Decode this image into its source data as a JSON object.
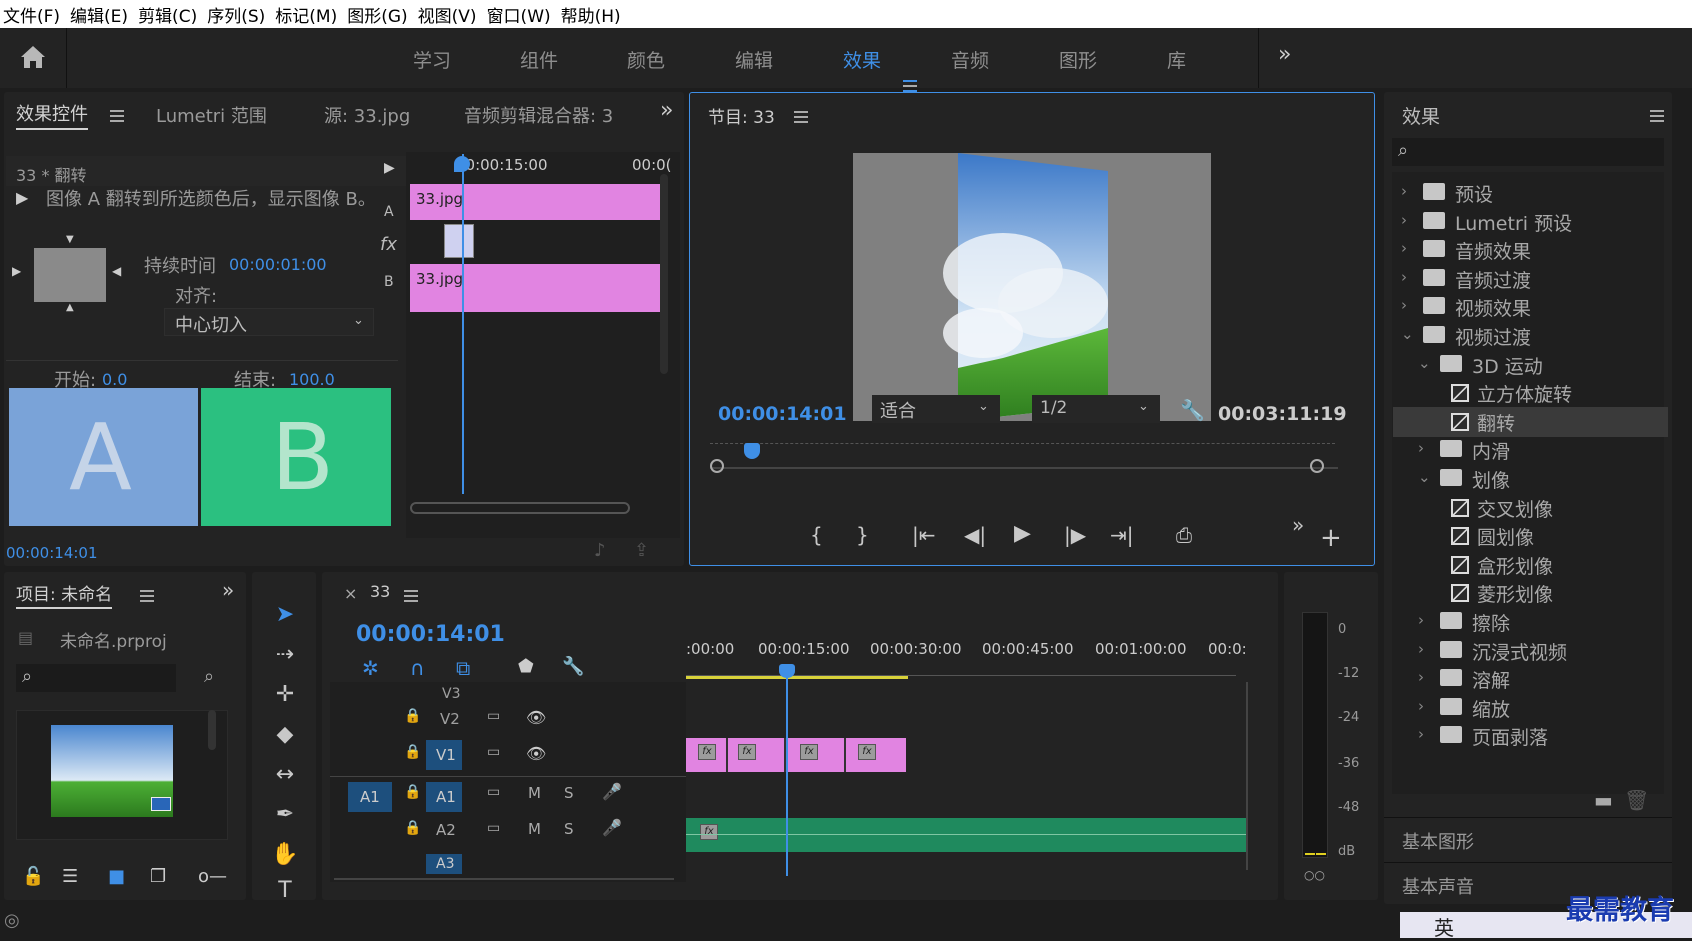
{
  "menu": [
    "文件(F)",
    "编辑(E)",
    "剪辑(C)",
    "序列(S)",
    "标记(M)",
    "图形(G)",
    "视图(V)",
    "窗口(W)",
    "帮助(H)"
  ],
  "workspaces": [
    "学习",
    "组件",
    "颜色",
    "编辑",
    "效果",
    "音频",
    "图形",
    "库"
  ],
  "workspace_active": "效果",
  "effect_controls": {
    "tabs": [
      "效果控件",
      "Lumetri 范围",
      "源: 33.jpg",
      "音频剪辑混合器: 3"
    ],
    "clip_title": "33 * 翻转",
    "description": "图像 A 翻转到所选颜色后，显示图像 B。",
    "duration_label": "持续时间",
    "duration_value": "00:00:01:00",
    "align_label": "对齐:",
    "align_value": "中心切入",
    "start_label": "开始:",
    "start_value": "0.0",
    "end_label": "结束:",
    "end_value": "100.0",
    "a_label": "A",
    "b_label": "B",
    "timecode": "00:00:14:01",
    "mini_timeline": {
      "ruler": [
        "00:00:15:00",
        "00:0("
      ],
      "clip_a": "33.jpg",
      "clip_b": "33.jpg",
      "track_a": "A",
      "track_b": "B",
      "fx": "fx"
    }
  },
  "program": {
    "title": "节目: 33",
    "timecode": "00:00:14:01",
    "fit": "适合",
    "quality": "1/2",
    "duration": "00:03:11:19"
  },
  "effects_panel": {
    "title": "效果",
    "items": [
      {
        "label": "预设",
        "level": 0,
        "type": "folder-star",
        "expanded": false
      },
      {
        "label": "Lumetri 预设",
        "level": 0,
        "type": "folder-star",
        "expanded": false
      },
      {
        "label": "音频效果",
        "level": 0,
        "type": "folder",
        "expanded": false
      },
      {
        "label": "音频过渡",
        "level": 0,
        "type": "folder",
        "expanded": false
      },
      {
        "label": "视频效果",
        "level": 0,
        "type": "folder",
        "expanded": false
      },
      {
        "label": "视频过渡",
        "level": 0,
        "type": "folder",
        "expanded": true
      },
      {
        "label": "3D 运动",
        "level": 1,
        "type": "folder",
        "expanded": true
      },
      {
        "label": "立方体旋转",
        "level": 2,
        "type": "effect"
      },
      {
        "label": "翻转",
        "level": 2,
        "type": "effect",
        "selected": true
      },
      {
        "label": "内滑",
        "level": 1,
        "type": "folder",
        "expanded": false
      },
      {
        "label": "划像",
        "level": 1,
        "type": "folder",
        "expanded": true
      },
      {
        "label": "交叉划像",
        "level": 2,
        "type": "effect"
      },
      {
        "label": "圆划像",
        "level": 2,
        "type": "effect"
      },
      {
        "label": "盒形划像",
        "level": 2,
        "type": "effect"
      },
      {
        "label": "菱形划像",
        "level": 2,
        "type": "effect"
      },
      {
        "label": "擦除",
        "level": 1,
        "type": "folder",
        "expanded": false
      },
      {
        "label": "沉浸式视频",
        "level": 1,
        "type": "folder",
        "expanded": false
      },
      {
        "label": "溶解",
        "level": 1,
        "type": "folder",
        "expanded": false
      },
      {
        "label": "缩放",
        "level": 1,
        "type": "folder",
        "expanded": false
      },
      {
        "label": "页面剥落",
        "level": 1,
        "type": "folder",
        "expanded": false
      }
    ],
    "essential_graphics": "基本图形",
    "essential_sound": "基本声音"
  },
  "project": {
    "title": "项目: 未命名",
    "file": "未命名.prproj"
  },
  "timeline": {
    "title": "33",
    "timecode": "00:00:14:01",
    "ruler": [
      ":00:00",
      "00:00:15:00",
      "00:00:30:00",
      "00:00:45:00",
      "00:01:00:00",
      "00:0:"
    ],
    "tracks": {
      "v3": "V3",
      "v2": "V2",
      "v1": "V1",
      "a1_src": "A1",
      "a1": "A1",
      "a2": "A2",
      "a3": "A3"
    },
    "mute": "M",
    "solo": "S",
    "fx": "fx"
  },
  "meter": {
    "labels": [
      "0",
      "-12",
      "-24",
      "-36",
      "-48",
      "dB"
    ]
  },
  "watermark": "最需教育",
  "ime": "英",
  "colors": {
    "accent": "#3f8fe6",
    "clip_video": "#e184e1",
    "clip_audio": "#1f8a5e",
    "a_block": "#7aa3d8",
    "b_block": "#2bc080"
  }
}
